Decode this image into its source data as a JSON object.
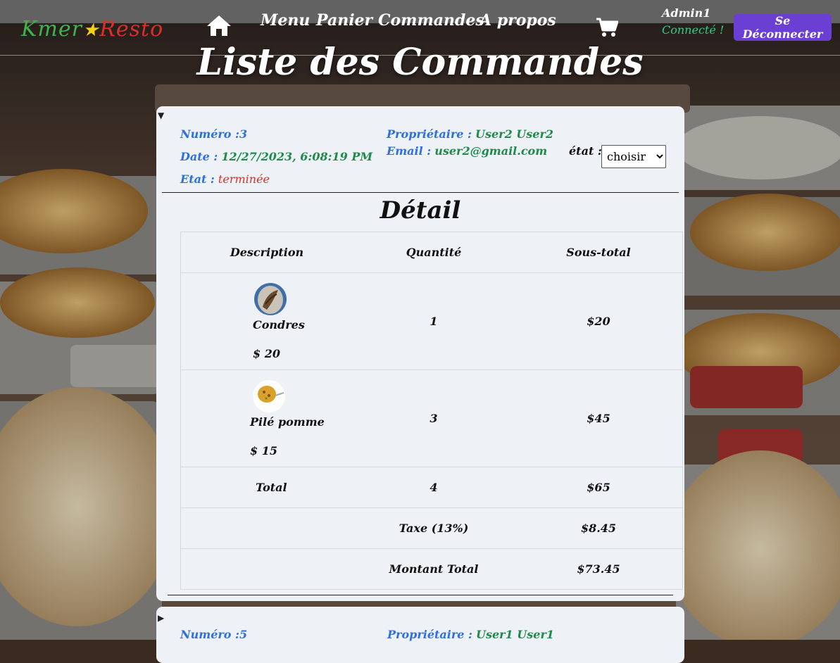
{
  "app": {
    "logo_left": "Kmer",
    "logo_star": "★",
    "logo_right": "Resto"
  },
  "nav": {
    "links": [
      "Menu",
      "Panier",
      "Commandes",
      "A propos"
    ],
    "user_name": "Admin1",
    "user_status": "Connecté !",
    "logout_label": "Se Déconnecter",
    "home_icon": "home-icon",
    "cart_icon": "shopping-cart-icon"
  },
  "page": {
    "title": "Liste des Commandes"
  },
  "orders": [
    {
      "numero_label": "Numéro :",
      "numero": "3",
      "date_label": "Date :",
      "date": "12/27/2023, 6:08:19 PM",
      "etat_label": "Etat :",
      "etat": "terminée",
      "owner_label": "Propriétaire :",
      "owner": "User2 User2",
      "email_label": "Email :",
      "email": "user2@gmail.com",
      "etat_select_label": "état :",
      "etat_select_value": "choisir",
      "detail_title": "Détail",
      "columns": [
        "Description",
        "Quantité",
        "Sous-total"
      ],
      "items": [
        {
          "name": "Condres",
          "price": "$ 20",
          "qty": "1",
          "subtotal": "$20"
        },
        {
          "name": "Pilé pomme",
          "price": "$ 15",
          "qty": "3",
          "subtotal": "$45"
        }
      ],
      "total_label": "Total",
      "total_qty": "4",
      "total_amount": "$65",
      "tax_label": "Taxe (13%)",
      "tax_amount": "$8.45",
      "grand_label": "Montant Total",
      "grand_amount": "$73.45"
    },
    {
      "numero_label": "Numéro :",
      "numero": "5",
      "owner_label": "Propriétaire :",
      "owner": "User1 User1"
    }
  ],
  "colors": {
    "accent_blue": "#2f6fe0",
    "value_green": "#1f8a4c",
    "status_red": "#d9302a",
    "logout_purple": "#6b3fd4",
    "connected_green": "#2ecc8f"
  }
}
